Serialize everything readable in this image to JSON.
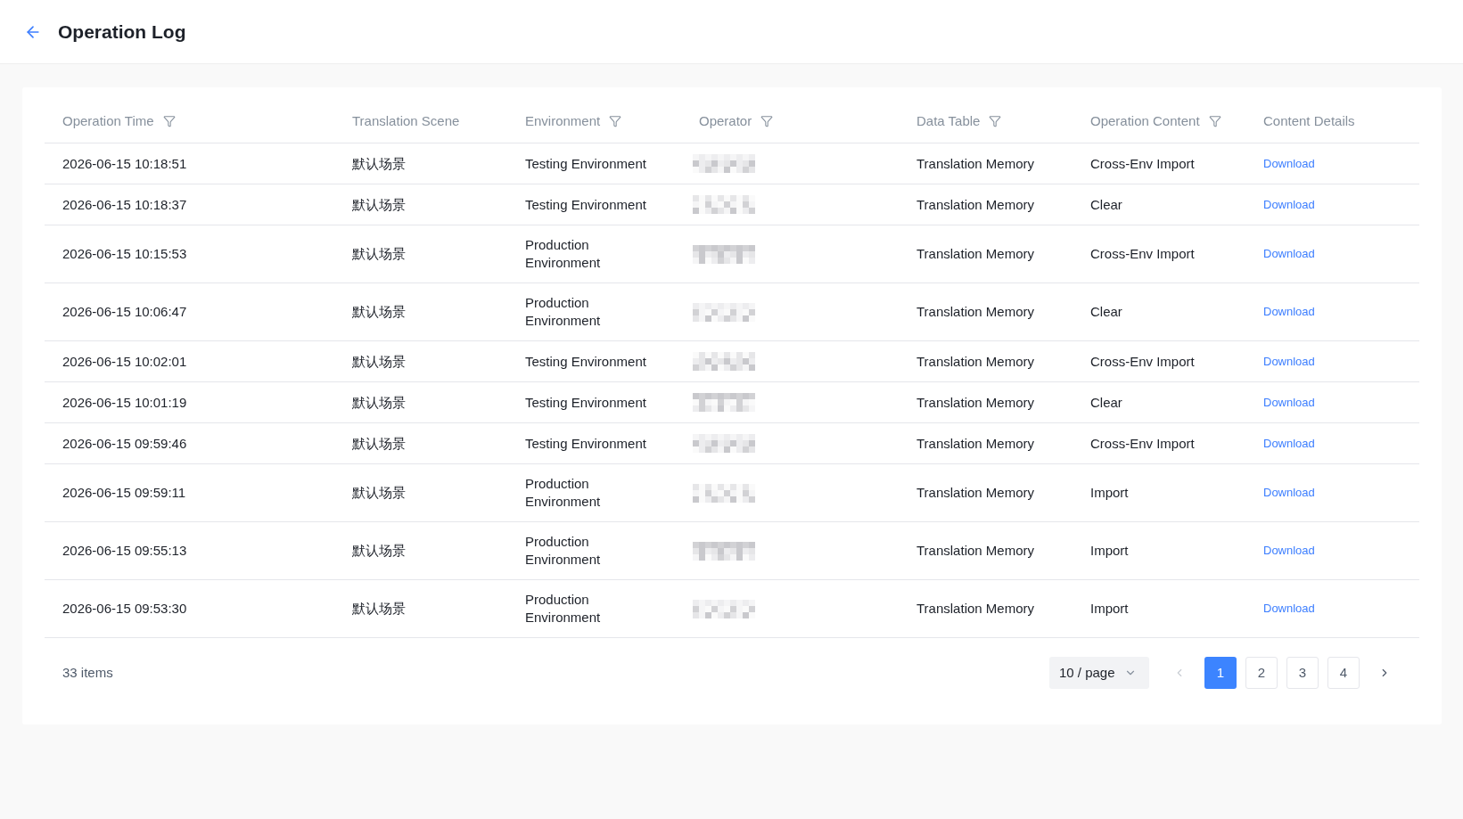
{
  "header": {
    "title": "Operation Log"
  },
  "table": {
    "columns": [
      {
        "label": "Operation Time",
        "filter": true
      },
      {
        "label": "Translation Scene",
        "filter": false
      },
      {
        "label": "Environment",
        "filter": true
      },
      {
        "label": "Operator",
        "filter": true
      },
      {
        "label": "Data Table",
        "filter": true
      },
      {
        "label": "Operation Content",
        "filter": true
      },
      {
        "label": "Content Details",
        "filter": false
      }
    ],
    "rows": [
      {
        "operation_time": "2026-06-15 10:18:51",
        "translation_scene": "默认场景",
        "environment": "Testing Environment",
        "data_table": "Translation Memory",
        "operation_content": "Cross-Env Import",
        "content_details": "Download"
      },
      {
        "operation_time": "2026-06-15 10:18:37",
        "translation_scene": "默认场景",
        "environment": "Testing Environment",
        "data_table": "Translation Memory",
        "operation_content": "Clear",
        "content_details": "Download"
      },
      {
        "operation_time": "2026-06-15 10:15:53",
        "translation_scene": "默认场景",
        "environment": "Production Environment",
        "data_table": "Translation Memory",
        "operation_content": "Cross-Env Import",
        "content_details": "Download"
      },
      {
        "operation_time": "2026-06-15 10:06:47",
        "translation_scene": "默认场景",
        "environment": "Production Environment",
        "data_table": "Translation Memory",
        "operation_content": "Clear",
        "content_details": "Download"
      },
      {
        "operation_time": "2026-06-15 10:02:01",
        "translation_scene": "默认场景",
        "environment": "Testing Environment",
        "data_table": "Translation Memory",
        "operation_content": "Cross-Env Import",
        "content_details": "Download"
      },
      {
        "operation_time": "2026-06-15 10:01:19",
        "translation_scene": "默认场景",
        "environment": "Testing Environment",
        "data_table": "Translation Memory",
        "operation_content": "Clear",
        "content_details": "Download"
      },
      {
        "operation_time": "2026-06-15 09:59:46",
        "translation_scene": "默认场景",
        "environment": "Testing Environment",
        "data_table": "Translation Memory",
        "operation_content": "Cross-Env Import",
        "content_details": "Download"
      },
      {
        "operation_time": "2026-06-15 09:59:11",
        "translation_scene": "默认场景",
        "environment": "Production Environment",
        "data_table": "Translation Memory",
        "operation_content": "Import",
        "content_details": "Download"
      },
      {
        "operation_time": "2026-06-15 09:55:13",
        "translation_scene": "默认场景",
        "environment": "Production Environment",
        "data_table": "Translation Memory",
        "operation_content": "Import",
        "content_details": "Download"
      },
      {
        "operation_time": "2026-06-15 09:53:30",
        "translation_scene": "默认场景",
        "environment": "Production Environment",
        "data_table": "Translation Memory",
        "operation_content": "Import",
        "content_details": "Download"
      }
    ]
  },
  "pagination": {
    "total": "33 items",
    "page_size": "10 / page",
    "prev": {
      "disabled": true
    },
    "pages": [
      {
        "label": "1",
        "selected": true
      },
      {
        "label": "2",
        "selected": false
      },
      {
        "label": "3",
        "selected": false
      },
      {
        "label": "4",
        "selected": false
      }
    ],
    "next": {
      "disabled": false
    }
  }
}
